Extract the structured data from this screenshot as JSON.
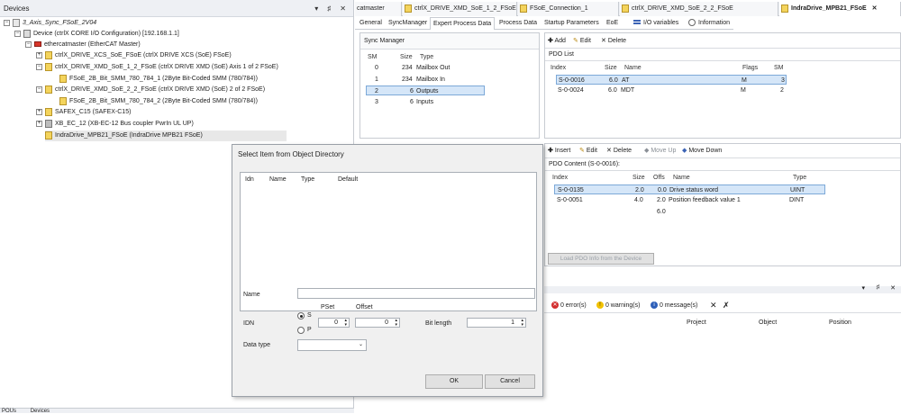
{
  "devices_panel": {
    "title": "Devices",
    "controls": [
      "▾",
      "♯",
      "✕"
    ],
    "tree": [
      {
        "label": "3_Axis_Sync_FSoE_2V04",
        "italic": true
      },
      {
        "label": "Device (ctrlX CORE I/O Configuration) [192.168.1.1]"
      },
      {
        "label": "ethercatmaster (EtherCAT Master)"
      },
      {
        "label": "ctrlX_DRIVE_XCS_SoE_FSoE (ctrlX DRIVE XCS (SoE) FSoE)"
      },
      {
        "label": "ctrlX_DRIVE_XMD_SoE_1_2_FSoE (ctrlX DRIVE XMD (SoE) Axis 1 of 2 FSoE)"
      },
      {
        "label": "FSoE_2B_Bit_SMM_780_784_1 (2Byte Bit-Coded SMM (780/784))"
      },
      {
        "label": "ctrlX_DRIVE_XMD_SoE_2_2_FSoE (ctrlX DRIVE XMD (SoE) 2 of 2 FSoE)"
      },
      {
        "label": "FSoE_2B_Bit_SMM_780_784_2 (2Byte Bit-Coded SMM (780/784))"
      },
      {
        "label": "SAFEX_C15 (SAFEX-C15)"
      },
      {
        "label": "XB_EC_12 (XB-EC-12 Bus coupler PwrIn UL UP)"
      },
      {
        "label": "IndraDrive_MPB21_FSoE (IndraDrive MPB21 FSoE)"
      }
    ],
    "bottom_tabs": [
      "POUs",
      "Devices"
    ]
  },
  "doc_tabs": [
    "catmaster",
    "ctrlX_DRIVE_XMD_SoE_1_2_FSoE",
    "FSoE_Connection_1",
    "ctrlX_DRIVE_XMD_SoE_2_2_FSoE",
    "IndraDrive_MPB21_FSoE"
  ],
  "doc_tab_close": "✕",
  "sub_tabs": [
    "General",
    "SyncManager",
    "Expert Process Data",
    "Process Data",
    "Startup Parameters",
    "EoE",
    "I/O variables",
    "Information"
  ],
  "sync_manager": {
    "title": "Sync Manager",
    "headers": [
      "SM",
      "Size",
      "Type"
    ],
    "rows": [
      {
        "sm": "0",
        "size": "234",
        "type": "Mailbox Out"
      },
      {
        "sm": "1",
        "size": "234",
        "type": "Mailbox In"
      },
      {
        "sm": "2",
        "size": "6",
        "type": "Outputs"
      },
      {
        "sm": "3",
        "size": "6",
        "type": "Inputs"
      }
    ],
    "selected_row": 2
  },
  "pdo_list": {
    "toolbar": {
      "add": "Add",
      "edit": "Edit",
      "delete": "Delete"
    },
    "title": "PDO List",
    "headers": [
      "Index",
      "Size",
      "Name",
      "Flags",
      "SM"
    ],
    "rows": [
      {
        "index": "S-0-0016",
        "size": "6.0",
        "name": "AT",
        "flags": "M",
        "sm": "3"
      },
      {
        "index": "S-0-0024",
        "size": "6.0",
        "name": "MDT",
        "flags": "M",
        "sm": "2"
      }
    ],
    "selected_row": 0
  },
  "pdo_content": {
    "toolbar": {
      "insert": "Insert",
      "edit": "Edit",
      "delete": "Delete",
      "move_up": "Move Up",
      "move_down": "Move Down"
    },
    "title": "PDO Content (S-0-0016):",
    "headers": [
      "Index",
      "Size",
      "Offs",
      "Name",
      "Type"
    ],
    "rows": [
      {
        "index": "S-0-0135",
        "size": "2.0",
        "offs": "0.0",
        "name": "Drive status word",
        "type": "UINT"
      },
      {
        "index": "S-0-0051",
        "size": "4.0",
        "offs": "2.0",
        "name": "Position feedback value 1",
        "type": "DINT"
      },
      {
        "index": "",
        "size": "",
        "offs": "6.0",
        "name": "",
        "type": ""
      }
    ],
    "selected_row": 0,
    "load_button": "Load PDO Info from the Device"
  },
  "messages": {
    "controls": [
      "▾",
      "♯",
      "✕"
    ],
    "errors": "0 error(s)",
    "warnings": "0 warning(s)",
    "messages": "0 message(s)",
    "headers": [
      "Project",
      "Object",
      "Position"
    ]
  },
  "dialog": {
    "title": "Select Item from Object Directory",
    "list_headers": [
      "Idn",
      "Name",
      "Type",
      "Default"
    ],
    "name_label": "Name",
    "name_value": "",
    "idn_label": "IDN",
    "pset_label": "PSet",
    "offset_label": "Offset",
    "radio_s": "S",
    "radio_p": "P",
    "radio_selected": "S",
    "pset_value": "0",
    "offset_value": "0",
    "bitlength_label": "Bit length",
    "bitlength_value": "1",
    "datatype_label": "Data type",
    "datatype_value": "",
    "ok_label": "OK",
    "cancel_label": "Cancel"
  }
}
